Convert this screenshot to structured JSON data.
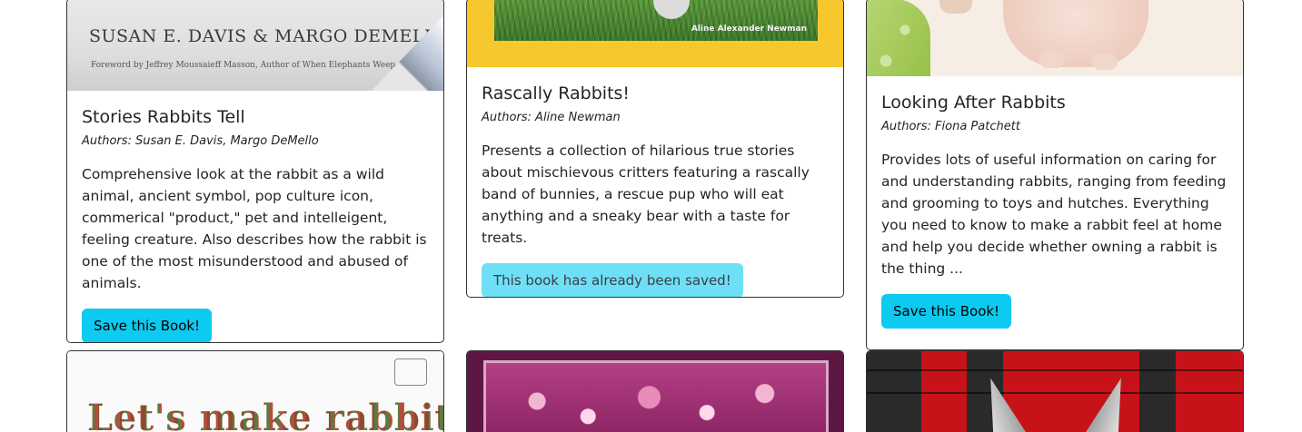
{
  "books": [
    {
      "title": "Stories Rabbits Tell",
      "authors": "Authors: Susan E. Davis, Margo DeMello",
      "description": "Comprehensive look at the rabbit as a wild animal, ancient symbol, pop culture icon, commerical \"product,\" pet and intelleigent, feeling creature. Also describes how the rabbit is one of the most misunderstood and abused of animals.",
      "button_label": "Save this Book!",
      "cover_text": "SUSAN E. DAVIS & MARGO DEMELLO",
      "cover_subtext": "Foreword by Jeffrey Moussaieff Masson, Author of When Elephants Weep"
    },
    {
      "title": "Rascally Rabbits!",
      "authors": "Authors: Aline Newman",
      "description": "Presents a collection of hilarious true stories about mischievous critters featuring a rascally band of bunnies, a rescue pup who will eat anything and a sneaky bear with a taste for treats.",
      "saved_label": "This book has already been saved!",
      "cover_text": "Aline Alexander Newman"
    },
    {
      "title": "Looking After Rabbits",
      "authors": "Authors: Fiona Patchett",
      "description": "Provides lots of useful information on caring for and understanding rabbits, ranging from feeding and grooming to toys and hutches. Everything you need to know to make a rabbit feel at home and help you decide whether owning a rabbit is the thing ...",
      "button_label": "Save this Book!"
    },
    {
      "cover_text": "Let's make rabbits"
    },
    {},
    {}
  ],
  "colors": {
    "save_button": "#0dcaf0",
    "saved_alert": "#6edff6"
  }
}
